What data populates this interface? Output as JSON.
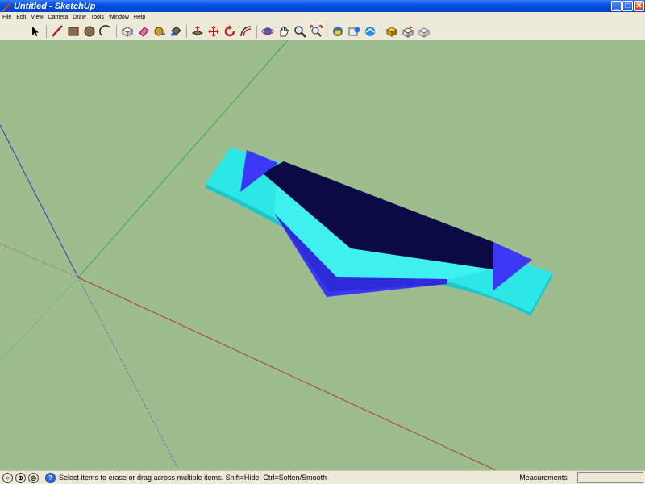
{
  "window": {
    "title": "Untitled - SketchUp",
    "buttons": {
      "minimize": "_",
      "maximize": "□",
      "close": "✕"
    }
  },
  "menu": [
    "File",
    "Edit",
    "View",
    "Camera",
    "Draw",
    "Tools",
    "Window",
    "Help"
  ],
  "toolbar": {
    "groups": [
      [
        "select-icon"
      ],
      [
        "line-icon",
        "rectangle-icon",
        "circle-icon",
        "arc-icon"
      ],
      [
        "make-component-icon",
        "eraser-icon",
        "tape-measure-icon",
        "paint-bucket-icon"
      ],
      [
        "push-pull-icon",
        "move-icon",
        "rotate-icon",
        "offset-icon"
      ],
      [
        "orbit-icon",
        "pan-icon",
        "zoom-icon",
        "zoom-extents-icon"
      ],
      [
        "get-models-icon",
        "share-model-icon",
        "get-photo-texture-icon"
      ],
      [
        "get-components-icon",
        "share-component-icon",
        "extension-warehouse-icon"
      ]
    ]
  },
  "colors": {
    "background": "#9dbd8f",
    "cyan": "#2de0e0",
    "blue": "#3a37f5",
    "navy": "#0c0a44",
    "axis_red": "#b03a2e",
    "axis_green": "#2fb03a",
    "axis_blue": "#2a3fc0"
  },
  "status": {
    "icons": [
      "geo-location-icon",
      "credits-icon",
      "user-icon",
      "help-icon"
    ],
    "text": "Select items to erase or drag across multiple items. Shift=Hide, Ctrl=Soften/Smooth",
    "measurements_label": "Measurements",
    "measurements_value": ""
  }
}
